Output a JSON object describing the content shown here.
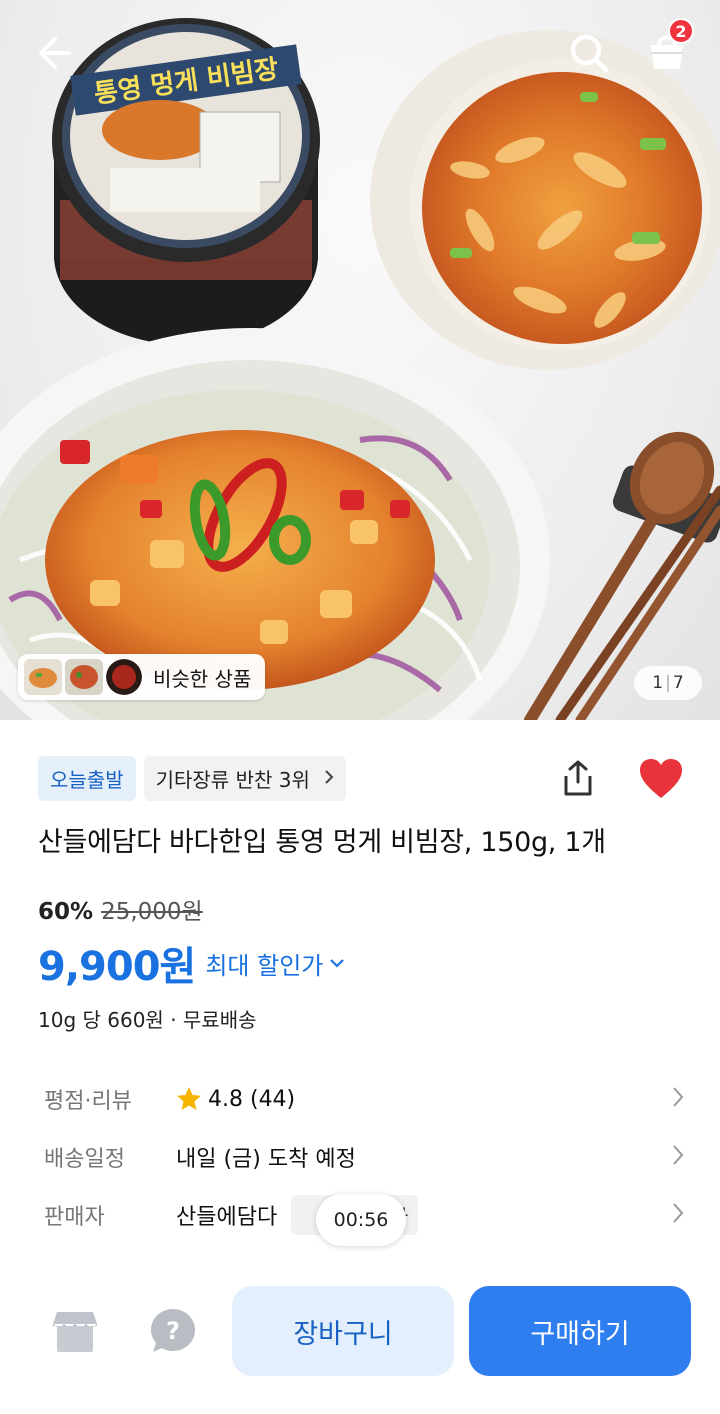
{
  "header": {
    "cart_count": "2"
  },
  "hero": {
    "product_label_text": "통영 멍게 비빔장",
    "brand_text": "바다한입",
    "similar_label": "비슷한 상품",
    "page_current": "1",
    "page_total": "7"
  },
  "badges": {
    "today_ship": "오늘출발",
    "ranking": "기타장류 반찬 3위"
  },
  "product": {
    "title": "산들에담다 바다한입 통영 멍게 비빔장, 150g, 1개",
    "discount_rate": "60%",
    "original_price": "25,000원",
    "price": "9,900원",
    "max_discount_label": "최대 할인가",
    "unit_info": "10g 당 660원 · 무료배송"
  },
  "info": {
    "rating_key": "평점·리뷰",
    "rating_value": "4.8 (44)",
    "delivery_key": "배송일정",
    "delivery_value": "내일 (금) 도착 예정",
    "seller_key": "판매자",
    "seller_value": "산들에담다",
    "seller_tag": "매자"
  },
  "timer": "00:56",
  "bottom": {
    "add_to_cart": "장바구니",
    "buy_now": "구매하기"
  },
  "colors": {
    "accent": "#1a72e0",
    "badge_red": "#f0323c",
    "heart": "#e8333a"
  }
}
